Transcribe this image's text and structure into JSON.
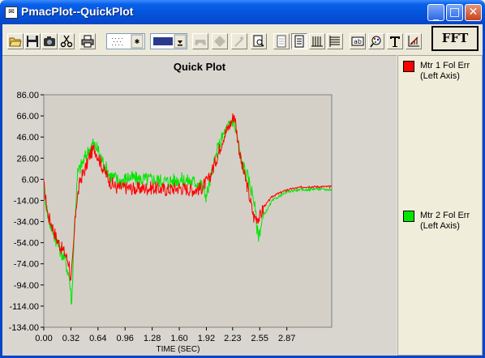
{
  "window": {
    "title": "PmacPlot--QuickPlot",
    "app_icon": "pmac-plot-icon",
    "controls": [
      "minimize",
      "maximize",
      "close"
    ]
  },
  "toolbar": {
    "buttons": [
      {
        "name": "open-icon",
        "enabled": true
      },
      {
        "name": "save-icon",
        "enabled": true
      },
      {
        "name": "camera-icon",
        "enabled": true
      },
      {
        "name": "cut-icon",
        "enabled": true
      },
      {
        "name": "print-icon",
        "enabled": true
      },
      {
        "name": "point-style-icon",
        "enabled": true
      },
      {
        "name": "point-style-dropdown",
        "enabled": true
      },
      {
        "name": "color-dropdown",
        "enabled": true
      },
      {
        "name": "gamepad-icon",
        "enabled": false
      },
      {
        "name": "diamond-icon",
        "enabled": false
      },
      {
        "name": "wand-icon",
        "enabled": false
      },
      {
        "name": "zoom-page-icon",
        "enabled": true
      },
      {
        "name": "page-icon",
        "enabled": true
      },
      {
        "name": "page-list-icon",
        "enabled": true
      },
      {
        "name": "vertical-grid-icon",
        "enabled": true
      },
      {
        "name": "horizontal-grid-icon",
        "enabled": true
      },
      {
        "name": "text-icon",
        "enabled": true
      },
      {
        "name": "color-picker-icon",
        "enabled": true
      },
      {
        "name": "font-icon",
        "enabled": true
      },
      {
        "name": "axis-settings-icon",
        "enabled": true
      }
    ],
    "fft_label": "FFT"
  },
  "plot": {
    "title": "Quick Plot"
  },
  "legend": {
    "items": [
      {
        "line1": "Mtr  1 Fol Err",
        "line2": "(Left Axis)",
        "color": "#FF0000"
      },
      {
        "line1": "Mtr  2 Fol Err",
        "line2": "(Left Axis)",
        "color": "#00E600"
      }
    ]
  },
  "chart_data": {
    "type": "line",
    "title": "Quick Plot",
    "xlabel": "TIME (SEC)",
    "ylabel": "",
    "xlim": [
      0.0,
      3.4
    ],
    "ylim": [
      -134,
      86
    ],
    "x_ticks": [
      "0.00",
      "0.32",
      "0.64",
      "0.96",
      "1.28",
      "1.60",
      "1.92",
      "2.23",
      "2.55",
      "2.87"
    ],
    "y_ticks": [
      "86.00",
      "66.00",
      "46.00",
      "26.00",
      "6.00",
      "-14.00",
      "-34.00",
      "-54.00",
      "-74.00",
      "-94.00",
      "-114.00",
      "-134.00"
    ],
    "grid": false,
    "legend_position": "right",
    "series": [
      {
        "name": "Mtr  1 Fol Err",
        "axis": "left",
        "color": "#FF0000",
        "points": [
          [
            0.0,
            0
          ],
          [
            0.05,
            -28
          ],
          [
            0.1,
            -38
          ],
          [
            0.15,
            -50
          ],
          [
            0.2,
            -58
          ],
          [
            0.25,
            -64
          ],
          [
            0.3,
            -74
          ],
          [
            0.32,
            -92
          ],
          [
            0.34,
            -72
          ],
          [
            0.38,
            -20
          ],
          [
            0.43,
            5
          ],
          [
            0.5,
            18
          ],
          [
            0.55,
            30
          ],
          [
            0.6,
            35
          ],
          [
            0.64,
            28
          ],
          [
            0.7,
            16
          ],
          [
            0.78,
            4
          ],
          [
            0.86,
            -2
          ],
          [
            0.96,
            -2
          ],
          [
            1.1,
            -3
          ],
          [
            1.28,
            -2
          ],
          [
            1.45,
            -4
          ],
          [
            1.6,
            -2
          ],
          [
            1.75,
            -4
          ],
          [
            1.85,
            -3
          ],
          [
            1.95,
            6
          ],
          [
            2.05,
            28
          ],
          [
            2.12,
            46
          ],
          [
            2.2,
            58
          ],
          [
            2.25,
            68
          ],
          [
            2.28,
            50
          ],
          [
            2.33,
            22
          ],
          [
            2.4,
            0
          ],
          [
            2.48,
            -30
          ],
          [
            2.55,
            -30
          ],
          [
            2.6,
            -20
          ],
          [
            2.7,
            -10
          ],
          [
            2.87,
            -4
          ],
          [
            3.0,
            -2
          ],
          [
            3.1,
            -1
          ],
          [
            3.2,
            -1
          ],
          [
            3.4,
            -1
          ]
        ]
      },
      {
        "name": "Mtr  2 Fol Err",
        "axis": "left",
        "color": "#00E600",
        "points": [
          [
            0.0,
            -1
          ],
          [
            0.05,
            -30
          ],
          [
            0.1,
            -42
          ],
          [
            0.15,
            -52
          ],
          [
            0.2,
            -62
          ],
          [
            0.25,
            -70
          ],
          [
            0.3,
            -86
          ],
          [
            0.33,
            -112
          ],
          [
            0.36,
            -40
          ],
          [
            0.4,
            12
          ],
          [
            0.46,
            22
          ],
          [
            0.52,
            32
          ],
          [
            0.58,
            40
          ],
          [
            0.64,
            34
          ],
          [
            0.7,
            22
          ],
          [
            0.78,
            10
          ],
          [
            0.9,
            4
          ],
          [
            1.0,
            8
          ],
          [
            1.12,
            6
          ],
          [
            1.28,
            6
          ],
          [
            1.45,
            4
          ],
          [
            1.6,
            6
          ],
          [
            1.75,
            4
          ],
          [
            1.85,
            2
          ],
          [
            1.92,
            -10
          ],
          [
            1.98,
            10
          ],
          [
            2.05,
            34
          ],
          [
            2.12,
            48
          ],
          [
            2.18,
            56
          ],
          [
            2.24,
            62
          ],
          [
            2.28,
            48
          ],
          [
            2.33,
            24
          ],
          [
            2.4,
            10
          ],
          [
            2.48,
            -12
          ],
          [
            2.53,
            -48
          ],
          [
            2.6,
            -28
          ],
          [
            2.7,
            -14
          ],
          [
            2.87,
            -6
          ],
          [
            3.0,
            -4
          ],
          [
            3.1,
            -4
          ],
          [
            3.2,
            -3
          ],
          [
            3.4,
            -4
          ]
        ]
      }
    ]
  }
}
